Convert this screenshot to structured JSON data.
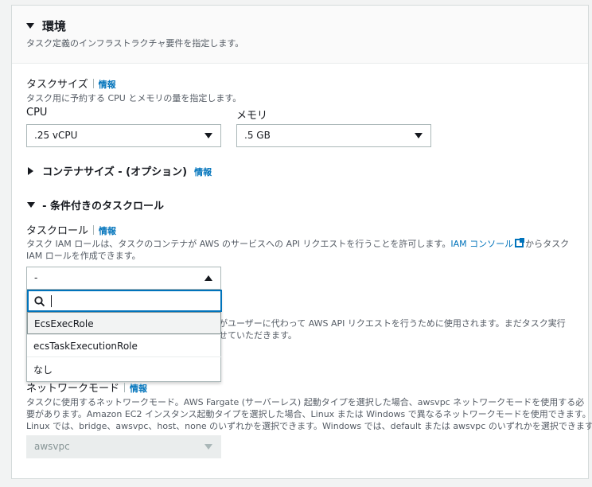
{
  "section": {
    "title": "環境",
    "description": "タスク定義のインフラストラクチャ要件を指定します。"
  },
  "task_size": {
    "label": "タスクサイズ",
    "info": "情報",
    "description": "タスク用に予約する CPU とメモリの量を指定します。",
    "cpu_label": "CPU",
    "cpu_value": ".25 vCPU",
    "memory_label": "メモリ",
    "memory_value": ".5 GB"
  },
  "container_size": {
    "label": "コンテナサイズ - (オプション)",
    "info": "情報"
  },
  "conditional_role": {
    "label": "- 条件付きのタスクロール"
  },
  "task_role": {
    "label": "タスクロール",
    "info": "情報",
    "description_pre": "タスク IAM ロールは、タスクのコンテナが AWS のサービスへの API リクエストを行うことを許可します。",
    "console_link": "IAM コンソール",
    "description_post": "からタスク",
    "description_line2": "IAM ロールを作成できます。",
    "selected_value": "-",
    "search_placeholder": "",
    "options": [
      "EcsExecRole",
      "ecsTaskExecutionRole",
      "なし"
    ]
  },
  "hidden_text": {
    "line1": "がユーザーに代わって AWS API リクエストを行うために使用されます。まだタスク実行",
    "line2": "せていただきます。"
  },
  "network_mode": {
    "label": "ネットワークモード",
    "info": "情報",
    "description_line1": "タスクに使用するネットワークモード。AWS Fargate (サーバーレス) 起動タイプを選択した場合、awsvpc ネットワークモードを使用する必",
    "description_line2": "要があります。Amazon EC2 インスタンス起動タイプを選択した場合、Linux または Windows で異なるネットワークモードを使用できます。",
    "description_line3": "Linux では、bridge、awsvpc、host、none のいずれかを選択できます。Windows では、default または awsvpc のいずれかを選択できます。",
    "value": "awsvpc"
  }
}
